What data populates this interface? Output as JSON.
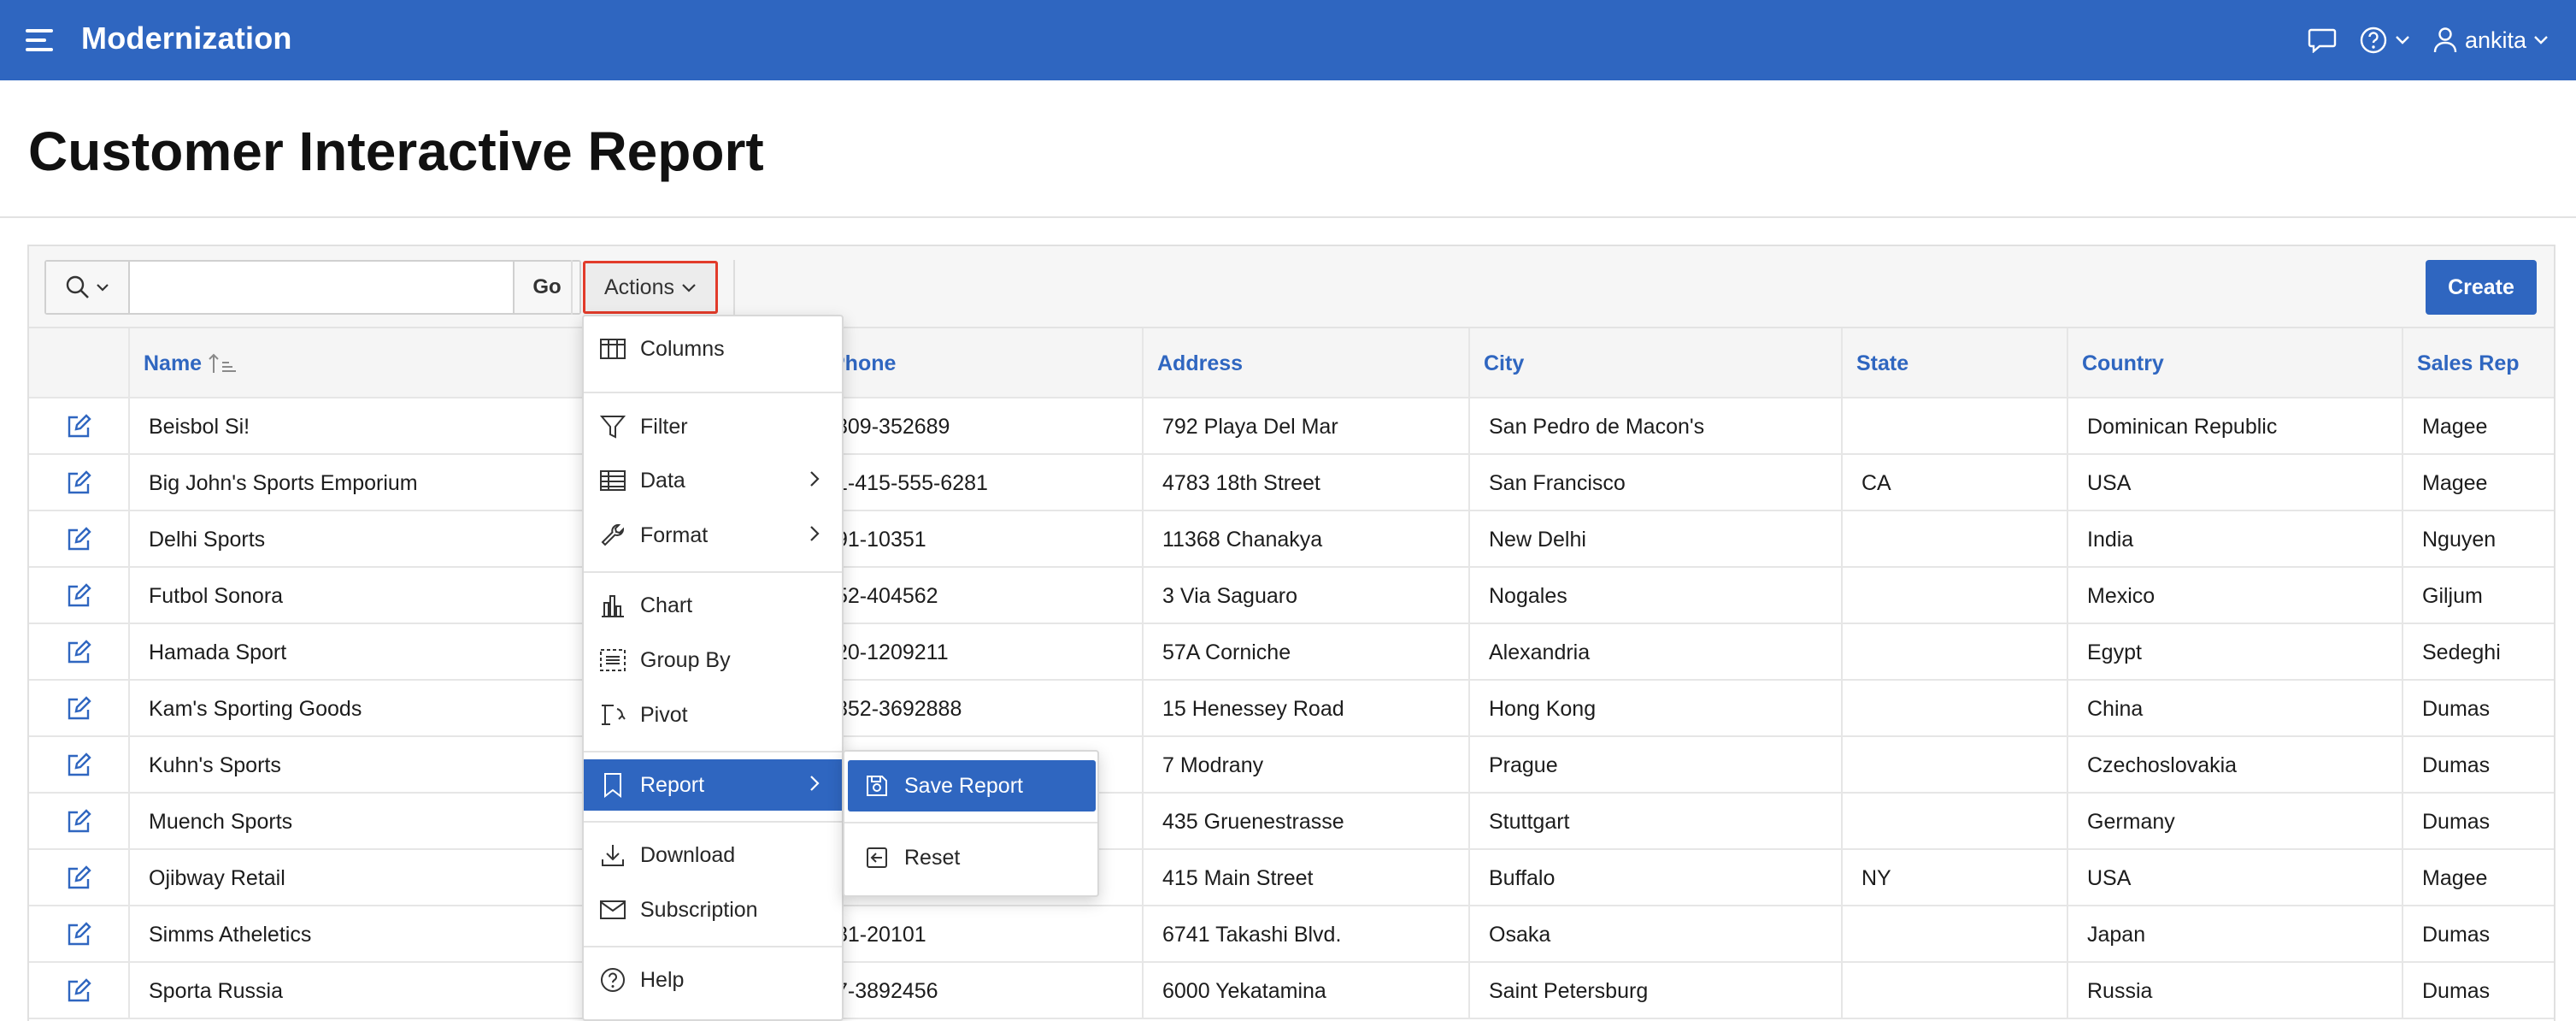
{
  "header": {
    "app_title": "Modernization",
    "user_name": "ankita",
    "icons": [
      "menu-icon",
      "chat-icon",
      "help-icon",
      "user-icon"
    ]
  },
  "page": {
    "title": "Customer Interactive Report"
  },
  "toolbar": {
    "search_placeholder": "",
    "search_value": "",
    "go_label": "Go",
    "actions_label": "Actions",
    "create_label": "Create"
  },
  "table": {
    "columns": [
      "Name",
      "Phone",
      "Address",
      "City",
      "State",
      "Country",
      "Sales Rep"
    ],
    "rows": [
      {
        "name": "Beisbol Si!",
        "phone": "809-352689",
        "address": "792 Playa Del Mar",
        "city": "San Pedro de Macon's",
        "state": "",
        "country": "Dominican Republic",
        "rep": "Magee"
      },
      {
        "name": "Big John's Sports Emporium",
        "phone": "1-415-555-6281",
        "address": "4783 18th Street",
        "city": "San Francisco",
        "state": "CA",
        "country": "USA",
        "rep": "Magee"
      },
      {
        "name": "Delhi Sports",
        "phone": "91-10351",
        "address": "11368 Chanakya",
        "city": "New Delhi",
        "state": "",
        "country": "India",
        "rep": "Nguyen"
      },
      {
        "name": "Futbol Sonora",
        "phone": "52-404562",
        "address": "3 Via Saguaro",
        "city": "Nogales",
        "state": "",
        "country": "Mexico",
        "rep": "Giljum"
      },
      {
        "name": "Hamada Sport",
        "phone": "20-1209211",
        "address": "57A Corniche",
        "city": "Alexandria",
        "state": "",
        "country": "Egypt",
        "rep": "Sedeghi"
      },
      {
        "name": "Kam's Sporting Goods",
        "phone": "852-3692888",
        "address": "15 Henessey Road",
        "city": "Hong Kong",
        "state": "",
        "country": "China",
        "rep": "Dumas"
      },
      {
        "name": "Kuhn's Sports",
        "phone": "",
        "address": "7 Modrany",
        "city": "Prague",
        "state": "",
        "country": "Czechoslovakia",
        "rep": "Dumas"
      },
      {
        "name": "Muench Sports",
        "phone": "",
        "address": "435 Gruenestrasse",
        "city": "Stuttgart",
        "state": "",
        "country": "Germany",
        "rep": "Dumas"
      },
      {
        "name": "Ojibway Retail",
        "phone": "",
        "address": "415 Main Street",
        "city": "Buffalo",
        "state": "NY",
        "country": "USA",
        "rep": "Magee"
      },
      {
        "name": "Simms Atheletics",
        "phone": "81-20101",
        "address": "6741 Takashi Blvd.",
        "city": "Osaka",
        "state": "",
        "country": "Japan",
        "rep": "Dumas"
      },
      {
        "name": "Sporta Russia",
        "phone": "7-3892456",
        "address": "6000 Yekatamina",
        "city": "Saint Petersburg",
        "state": "",
        "country": "Russia",
        "rep": "Dumas"
      }
    ]
  },
  "actions_menu": {
    "items": [
      "Columns",
      "Filter",
      "Data",
      "Format",
      "Chart",
      "Group By",
      "Pivot",
      "Report",
      "Download",
      "Subscription",
      "Help"
    ],
    "active": "Report"
  },
  "report_submenu": {
    "items": [
      "Save Report",
      "Reset"
    ],
    "active": "Save Report"
  },
  "colors": {
    "brand": "#2f66c0",
    "highlight_border": "#e23b2a"
  }
}
